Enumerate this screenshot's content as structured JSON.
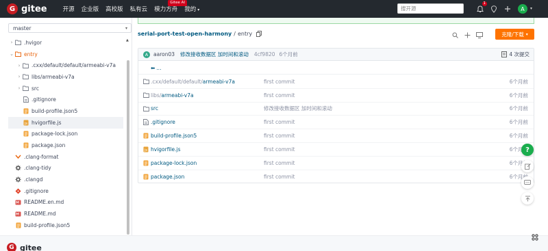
{
  "navbar": {
    "brand": "gitee",
    "items": [
      "开源",
      "企业版",
      "高校版",
      "私有云",
      "模力方舟",
      "我的"
    ],
    "badge": "Gitee AI",
    "search_placeholder": "搜开源",
    "notification_count": "1",
    "avatar_letter": "A"
  },
  "sidebar": {
    "branch": "master",
    "tree": [
      {
        "label": ".hvigor",
        "type": "folder",
        "arrow": "›",
        "indent": 0
      },
      {
        "label": "entry",
        "type": "folder-open",
        "arrow": "⌄",
        "indent": 0
      },
      {
        "label": ".cxx/default/default/armeabi-v7a",
        "type": "folder",
        "arrow": "›",
        "indent": 1
      },
      {
        "label": "libs/armeabi-v7a",
        "type": "folder",
        "arrow": "›",
        "indent": 1
      },
      {
        "label": "src",
        "type": "folder",
        "arrow": "›",
        "indent": 1
      },
      {
        "label": ".gitignore",
        "type": "file",
        "arrow": "",
        "indent": 1
      },
      {
        "label": "build-profile.json5",
        "type": "json",
        "arrow": "",
        "indent": 1
      },
      {
        "label": "hvigorfile.js",
        "type": "js",
        "arrow": "",
        "indent": 1
      },
      {
        "label": "package-lock.json",
        "type": "json",
        "arrow": "",
        "indent": 1
      },
      {
        "label": "package.json",
        "type": "json",
        "arrow": "",
        "indent": 1
      },
      {
        "label": ".clang-format",
        "type": "clang",
        "arrow": "",
        "indent": 0
      },
      {
        "label": ".clang-tidy",
        "type": "gear",
        "arrow": "",
        "indent": 0
      },
      {
        "label": ".clangd",
        "type": "gear",
        "arrow": "",
        "indent": 0
      },
      {
        "label": ".gitignore",
        "type": "git",
        "arrow": "",
        "indent": 0
      },
      {
        "label": "README.en.md",
        "type": "md",
        "arrow": "",
        "indent": 0
      },
      {
        "label": "README.md",
        "type": "md",
        "arrow": "",
        "indent": 0
      },
      {
        "label": "build-profile.json5",
        "type": "json",
        "arrow": "",
        "indent": 0
      }
    ]
  },
  "main": {
    "repo_name": "serial-port-test-open-harmony",
    "separator": "/",
    "current_dir": "entry",
    "clone_label": "克隆/下载",
    "commit": {
      "author": "aaron03",
      "author_initial": "A",
      "message": "修改接收数据区 加时间和滚动",
      "hash": "4cf9820",
      "time": "6个月前",
      "count": "4 次提交"
    },
    "back_label": "...",
    "files": [
      {
        "prefix": ".cxx/default/default/",
        "name": "armeabi-v7a",
        "type": "folder",
        "message": "first commit",
        "time": "6个月前"
      },
      {
        "prefix": "libs/",
        "name": "armeabi-v7a",
        "type": "folder",
        "message": "first commit",
        "time": "6个月前"
      },
      {
        "prefix": "",
        "name": "src",
        "type": "folder",
        "message": "修改接收数据区 加时间和滚动",
        "time": "6个月前"
      },
      {
        "prefix": "",
        "name": ".gitignore",
        "type": "file",
        "message": "first commit",
        "time": "6个月前"
      },
      {
        "prefix": "",
        "name": "build-profile.json5",
        "type": "json",
        "message": "first commit",
        "time": "6个月前"
      },
      {
        "prefix": "",
        "name": "hvigorfile.js",
        "type": "js",
        "message": "first commit",
        "time": "6个月前"
      },
      {
        "prefix": "",
        "name": "package-lock.json",
        "type": "json",
        "message": "first commit",
        "time": "6个月前"
      },
      {
        "prefix": "",
        "name": "package.json",
        "type": "json",
        "message": "first commit",
        "time": "6个月前"
      }
    ]
  },
  "footer": {
    "brand": "gitee"
  },
  "colors": {
    "navbar_bg": "#24292f",
    "accent_orange": "#fe7300",
    "link_blue": "#005980",
    "brand_red": "#c71d23",
    "green": "#1aad4d"
  }
}
